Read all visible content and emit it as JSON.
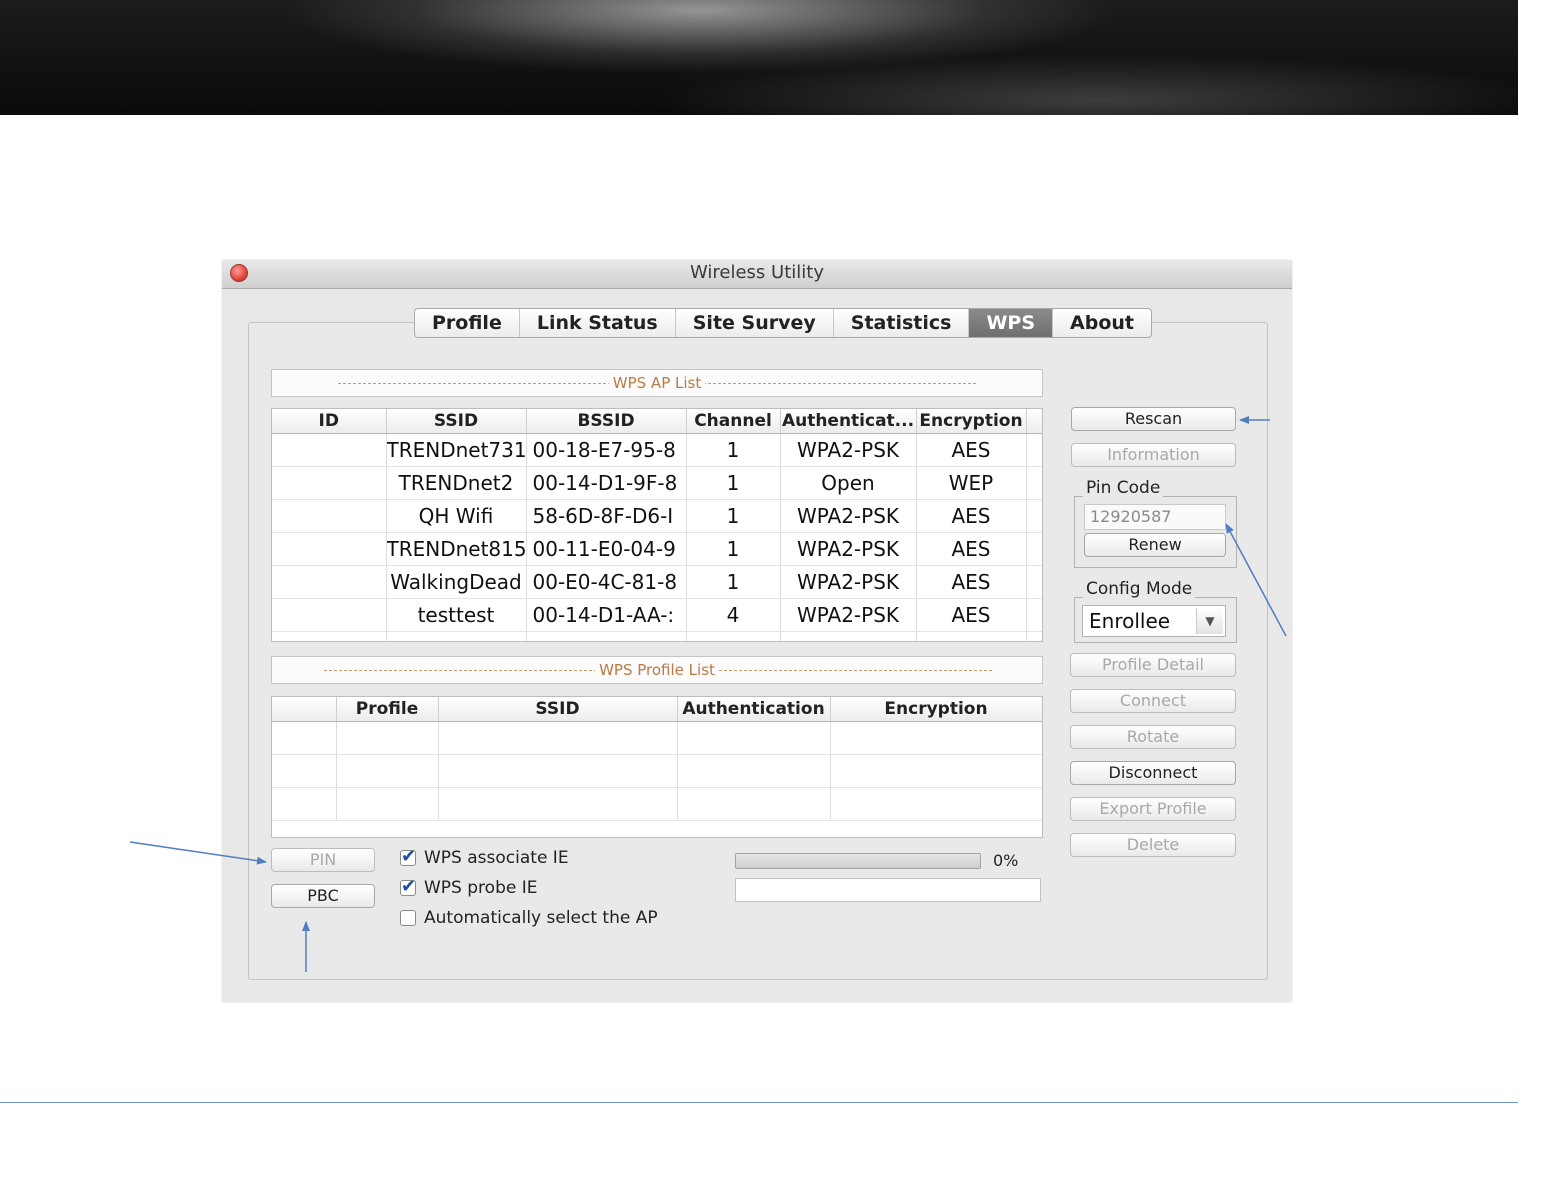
{
  "window": {
    "title": "Wireless Utility"
  },
  "tabs": [
    {
      "label": "Profile",
      "active": false
    },
    {
      "label": "Link Status",
      "active": false
    },
    {
      "label": "Site Survey",
      "active": false
    },
    {
      "label": "Statistics",
      "active": false
    },
    {
      "label": "WPS",
      "active": true
    },
    {
      "label": "About",
      "active": false
    }
  ],
  "ap_list": {
    "title": "WPS AP List",
    "columns": [
      "ID",
      "SSID",
      "BSSID",
      "Channel",
      "Authenticat...",
      "Encryption"
    ],
    "rows": [
      {
        "id": "",
        "ssid": "TRENDnet731",
        "bssid": "00-18-E7-95-8",
        "channel": "1",
        "auth": "WPA2-PSK",
        "encryption": "AES"
      },
      {
        "id": "",
        "ssid": "TRENDnet2",
        "bssid": "00-14-D1-9F-8",
        "channel": "1",
        "auth": "Open",
        "encryption": "WEP"
      },
      {
        "id": "",
        "ssid": "QH Wifi",
        "bssid": "58-6D-8F-D6-I",
        "channel": "1",
        "auth": "WPA2-PSK",
        "encryption": "AES"
      },
      {
        "id": "",
        "ssid": "TRENDnet815",
        "bssid": "00-11-E0-04-9",
        "channel": "1",
        "auth": "WPA2-PSK",
        "encryption": "AES"
      },
      {
        "id": "",
        "ssid": "WalkingDead",
        "bssid": "00-E0-4C-81-8",
        "channel": "1",
        "auth": "WPA2-PSK",
        "encryption": "AES"
      },
      {
        "id": "",
        "ssid": "testtest",
        "bssid": "00-14-D1-AA-:",
        "channel": "4",
        "auth": "WPA2-PSK",
        "encryption": "AES"
      }
    ]
  },
  "profile_list": {
    "title": "WPS Profile List",
    "columns": [
      "",
      "Profile",
      "SSID",
      "Authentication",
      "Encryption"
    ]
  },
  "side_buttons": {
    "rescan": "Rescan",
    "information": "Information",
    "pin_code_label": "Pin Code",
    "pin_code_value": "12920587",
    "renew": "Renew",
    "config_mode_label": "Config Mode",
    "config_mode_value": "Enrollee",
    "profile_detail": "Profile Detail",
    "connect": "Connect",
    "rotate": "Rotate",
    "disconnect": "Disconnect",
    "export_profile": "Export Profile",
    "delete": "Delete"
  },
  "bottom": {
    "pin_button": "PIN",
    "pbc_button": "PBC",
    "wps_associate_ie": {
      "label": "WPS associate IE",
      "checked": true
    },
    "wps_probe_ie": {
      "label": "WPS probe IE",
      "checked": true
    },
    "auto_select_ap": {
      "label": "Automatically select the AP",
      "checked": false
    },
    "progress_percent": 0,
    "progress_label": "0%"
  },
  "colors": {
    "annotation_arrow": "#4f7fc0",
    "section_title": "#b87b45",
    "active_tab": "#7a7a7a"
  }
}
